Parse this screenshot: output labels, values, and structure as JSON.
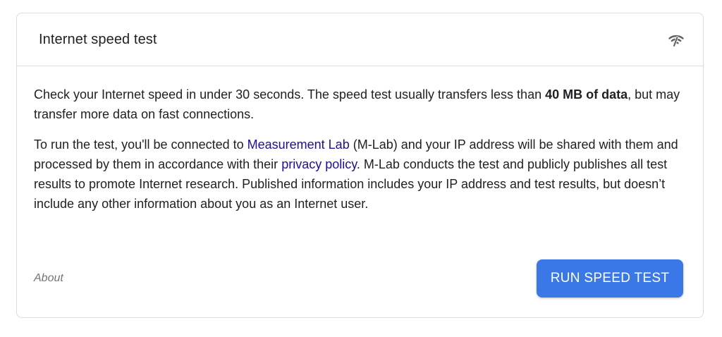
{
  "card": {
    "title": "Internet speed test",
    "icon": "wifi-speed-icon"
  },
  "body": {
    "p1_text_1": "Check your Internet speed in under 30 seconds. The speed test usually transfers less than ",
    "p1_bold": "40 MB of data",
    "p1_text_2": ", but may transfer more data on fast connections.",
    "p2_text_1": "To run the test, you'll be connected to ",
    "p2_link_1": "Measurement Lab",
    "p2_text_2": " (M-Lab) and your IP address will be shared with them and processed by them in accordance with their ",
    "p2_link_2": "privacy policy",
    "p2_text_3": ". M-Lab conducts the test and publicly publishes all test results to promote Internet research. Published information includes your IP address and test results, but doesn’t include any other information about you as an Internet user."
  },
  "footer": {
    "about_label": "About",
    "run_button_label": "RUN SPEED TEST"
  },
  "colors": {
    "button_bg": "#3b78e7",
    "link": "#1a0dab",
    "border": "#dadce0"
  }
}
